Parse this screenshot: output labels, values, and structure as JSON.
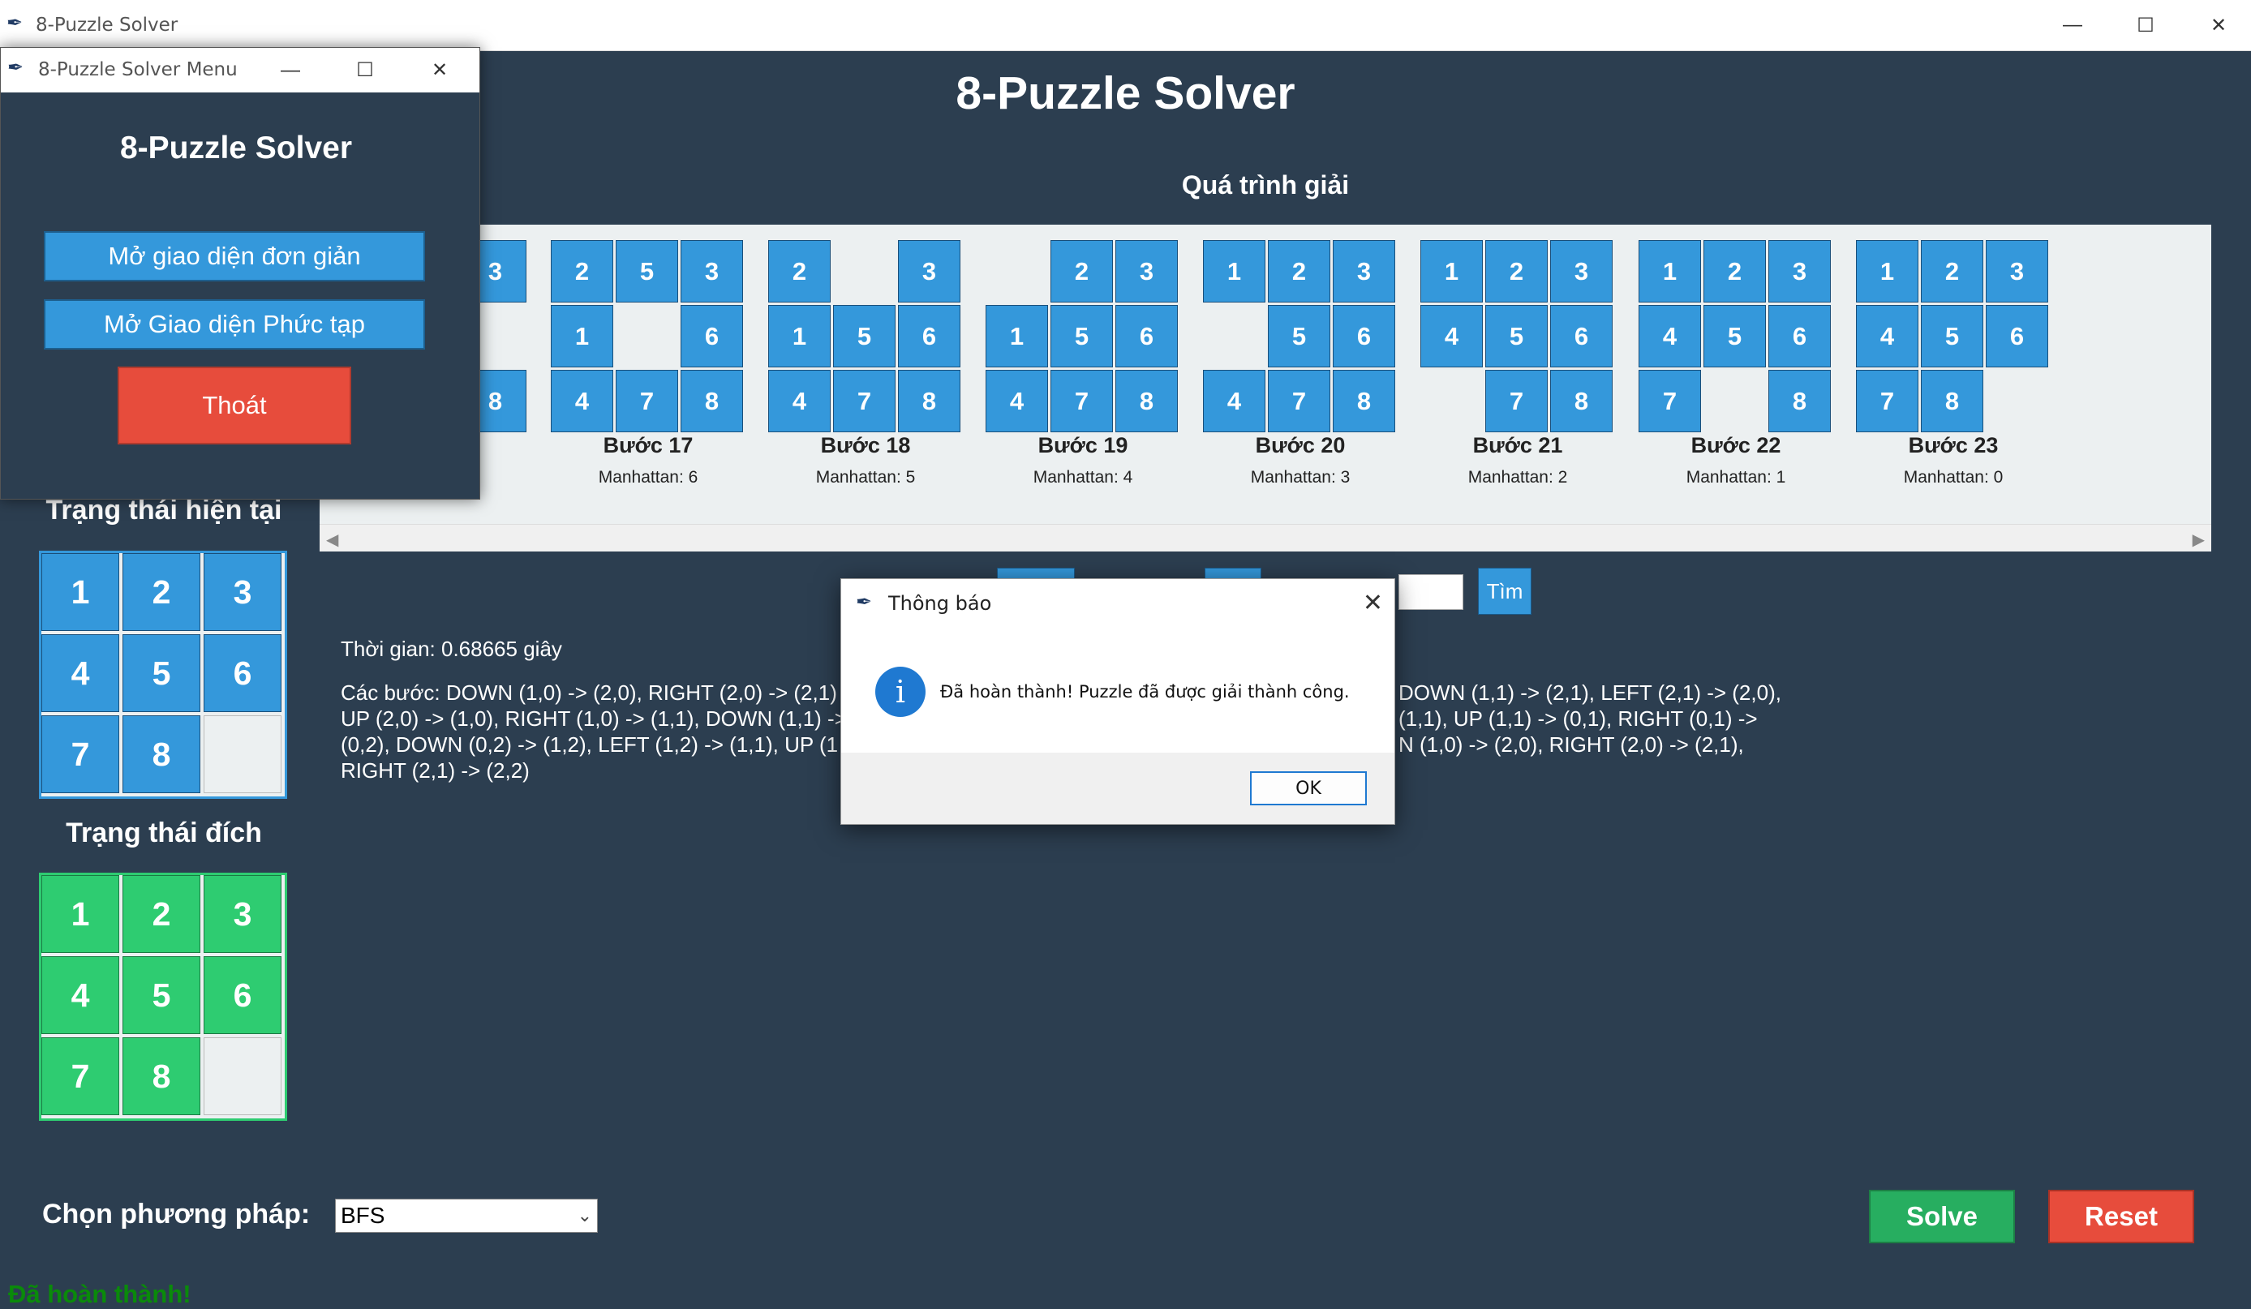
{
  "main_window": {
    "title": "8-Puzzle Solver",
    "controls": {
      "minimize": "—",
      "maximize": "☐",
      "close": "✕"
    }
  },
  "app_title": "8-Puzzle Solver",
  "process_label": "Quá trình giải",
  "steps": [
    {
      "name": "Bước 17",
      "manhattan": "Manhattan: 6",
      "tiles": [
        "2",
        "5",
        "3",
        "1",
        "",
        "6",
        "4",
        "7",
        "8"
      ]
    },
    {
      "name": "Bước 18",
      "manhattan": "Manhattan: 5",
      "tiles": [
        "2",
        "",
        "3",
        "1",
        "5",
        "6",
        "4",
        "7",
        "8"
      ]
    },
    {
      "name": "Bước 19",
      "manhattan": "Manhattan: 4",
      "tiles": [
        "",
        "2",
        "3",
        "1",
        "5",
        "6",
        "4",
        "7",
        "8"
      ]
    },
    {
      "name": "Bước 20",
      "manhattan": "Manhattan: 3",
      "tiles": [
        "1",
        "2",
        "3",
        "",
        "5",
        "6",
        "4",
        "7",
        "8"
      ]
    },
    {
      "name": "Bước 21",
      "manhattan": "Manhattan: 2",
      "tiles": [
        "1",
        "2",
        "3",
        "4",
        "5",
        "6",
        "",
        "7",
        "8"
      ]
    },
    {
      "name": "Bước 22",
      "manhattan": "Manhattan: 1",
      "tiles": [
        "1",
        "2",
        "3",
        "4",
        "5",
        "6",
        "7",
        "",
        "8"
      ]
    },
    {
      "name": "Bước 23",
      "manhattan": "Manhattan: 0",
      "tiles": [
        "1",
        "2",
        "3",
        "4",
        "5",
        "6",
        "7",
        "8",
        ""
      ]
    }
  ],
  "partial_step_tiles": [
    "3",
    "",
    "8"
  ],
  "current_state_label": "Trạng thái hiện tại",
  "current_state": [
    "1",
    "2",
    "3",
    "4",
    "5",
    "6",
    "7",
    "8",
    ""
  ],
  "goal_state_label": "Trạng thái đích",
  "goal_state": [
    "1",
    "2",
    "3",
    "4",
    "5",
    "6",
    "7",
    "8",
    ""
  ],
  "time_text": "Thời gian: 0.68665 giây",
  "steps_text_lines": [
    "Các bước: DOWN (1,0) -> (2,0), RIGHT (2,0) -> (2,1)",
    "UP (2,0) -> (1,0), RIGHT (1,0) -> (1,1), DOWN (1,1) ->",
    "(0,2), DOWN (0,2) -> (1,2), LEFT (1,2) -> (1,1), UP (1",
    "RIGHT (2,1) -> (2,2)"
  ],
  "steps_text_right_lines": [
    "DOWN (1,1) -> (2,1), LEFT (2,1) -> (2,0),",
    "(1,1), UP (1,1) -> (0,1), RIGHT (0,1) ->",
    "N (1,0) -> (2,0), RIGHT (2,0) -> (2,1),"
  ],
  "find_button": "Tìm",
  "method_label": "Chọn phương pháp:",
  "method_value": "BFS",
  "solve_button": "Solve",
  "reset_button": "Reset",
  "status_text": "Đã hoàn thành!",
  "menu_window": {
    "title": "8-Puzzle Solver Menu",
    "heading": "8-Puzzle Solver",
    "simple_button": "Mở giao diện đơn giản",
    "complex_button": "Mở Giao diện Phức tạp",
    "exit_button": "Thoát"
  },
  "dialog": {
    "title": "Thông báo",
    "message": "Đã hoàn thành! Puzzle đã được giải thành công.",
    "ok_button": "OK",
    "icon": "info-icon"
  },
  "colors": {
    "background": "#2c3e50",
    "tile_blue": "#3498db",
    "tile_green": "#2ecc71",
    "solve": "#27ae60",
    "reset": "#e74c3c",
    "status": "#0a8a0a"
  }
}
